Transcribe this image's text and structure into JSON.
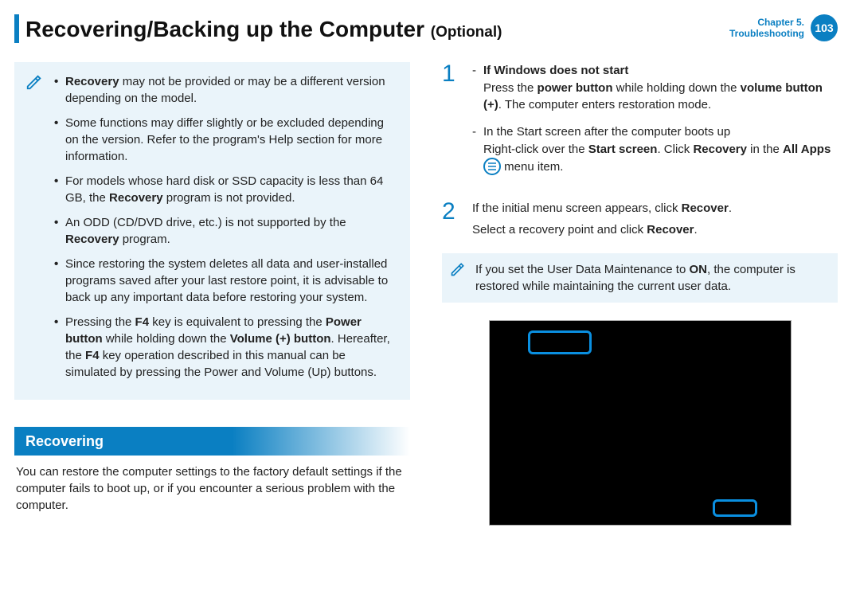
{
  "header": {
    "title_main": "Recovering/Backing up the Computer ",
    "title_sub": "(Optional)",
    "chapter_line1": "Chapter 5.",
    "chapter_line2": "Troubleshooting",
    "page_number": "103"
  },
  "left": {
    "notes": {
      "b1_pre": "",
      "b1_bold": "Recovery",
      "b1_post": " may not be provided or may be a different version depending on the model.",
      "b2": "Some functions may differ slightly or be excluded depending on the version. Refer to the program's Help section for more information.",
      "b3_pre": "For models whose hard disk or SSD capacity is less than 64 GB, the ",
      "b3_bold": "Recovery",
      "b3_post": " program is not provided.",
      "b4_pre": "An ODD (CD/DVD drive, etc.) is not supported by the ",
      "b4_bold": "Recovery",
      "b4_post": " program.",
      "b5": "Since restoring the system deletes all data and user-installed programs saved after your last restore point, it is advisable to back up any important data before restoring your system.",
      "b6_pre": "Pressing the ",
      "b6_k1": "F4",
      "b6_mid1": " key is equivalent to pressing the ",
      "b6_k2": "Power button",
      "b6_mid2": " while holding down the ",
      "b6_k3": "Volume (+) button",
      "b6_mid3": ". Hereafter, the ",
      "b6_k4": "F4",
      "b6_post": " key operation described in this manual can be simulated by pressing the Power and Volume (Up) buttons."
    },
    "section_heading": "Recovering",
    "body": "You can restore the computer settings to the factory default settings if the computer fails to boot up, or if you encounter a serious problem with the computer."
  },
  "right": {
    "step1": {
      "num": "1",
      "d1_title": "If Windows does not start",
      "d1_pre": "Press the ",
      "d1_b1": "power button",
      "d1_mid": " while holding down the ",
      "d1_b2": "volume button (+)",
      "d1_post": ". The computer enters restoration mode.",
      "d2_title": "In the Start screen after the computer boots up",
      "d2_pre": "Right-click over the ",
      "d2_b1": "Start screen",
      "d2_mid1": ". Click ",
      "d2_b2": "Recovery",
      "d2_mid2": " in the ",
      "d2_b3": "All Apps",
      "d2_post": " menu item."
    },
    "step2": {
      "num": "2",
      "line1_pre": "If the initial menu screen appears, click ",
      "line1_bold": "Recover",
      "line1_post": ".",
      "line2_pre": "Select a recovery point and click ",
      "line2_bold": "Recover",
      "line2_post": "."
    },
    "note2_pre": "If you set the User Data Maintenance to ",
    "note2_bold": "ON",
    "note2_post": ", the computer is restored while maintaining the current user data."
  }
}
